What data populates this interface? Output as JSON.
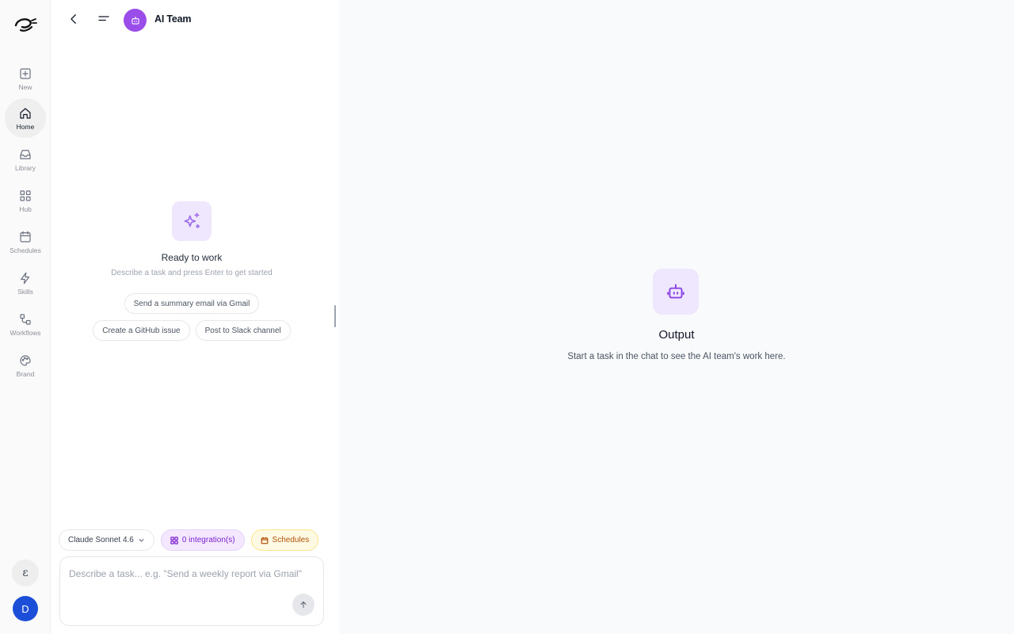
{
  "sidebar": {
    "items": [
      {
        "label": "New",
        "icon": "plus-square-icon"
      },
      {
        "label": "Home",
        "icon": "home-icon"
      },
      {
        "label": "Library",
        "icon": "inbox-icon"
      },
      {
        "label": "Hub",
        "icon": "grid-icon"
      },
      {
        "label": "Schedules",
        "icon": "calendar-icon"
      },
      {
        "label": "Skills",
        "icon": "lightning-icon"
      },
      {
        "label": "Workflows",
        "icon": "workflow-icon"
      },
      {
        "label": "Brand",
        "icon": "palette-icon"
      }
    ],
    "extension_glyph": "ɛ",
    "avatar_initial": "D"
  },
  "chat": {
    "header": {
      "title": "AI Team"
    },
    "empty_state": {
      "title": "Ready to work",
      "subtitle": "Describe a task and press Enter to get started",
      "suggestions": [
        "Send a summary email via Gmail",
        "Create a GitHub issue",
        "Post to Slack channel"
      ]
    },
    "composer": {
      "model_label": "Claude Sonnet 4.6",
      "integrations_label": "0 integration(s)",
      "schedules_label": "Schedules",
      "placeholder": "Describe a task... e.g. \"Send a weekly report via Gmail\""
    }
  },
  "output": {
    "title": "Output",
    "subtitle": "Start a task in the chat to see the AI team's work here."
  },
  "colors": {
    "accent": "#9b4dea",
    "accent_soft": "#efe7fd",
    "avatar": "#1d4ed8"
  }
}
